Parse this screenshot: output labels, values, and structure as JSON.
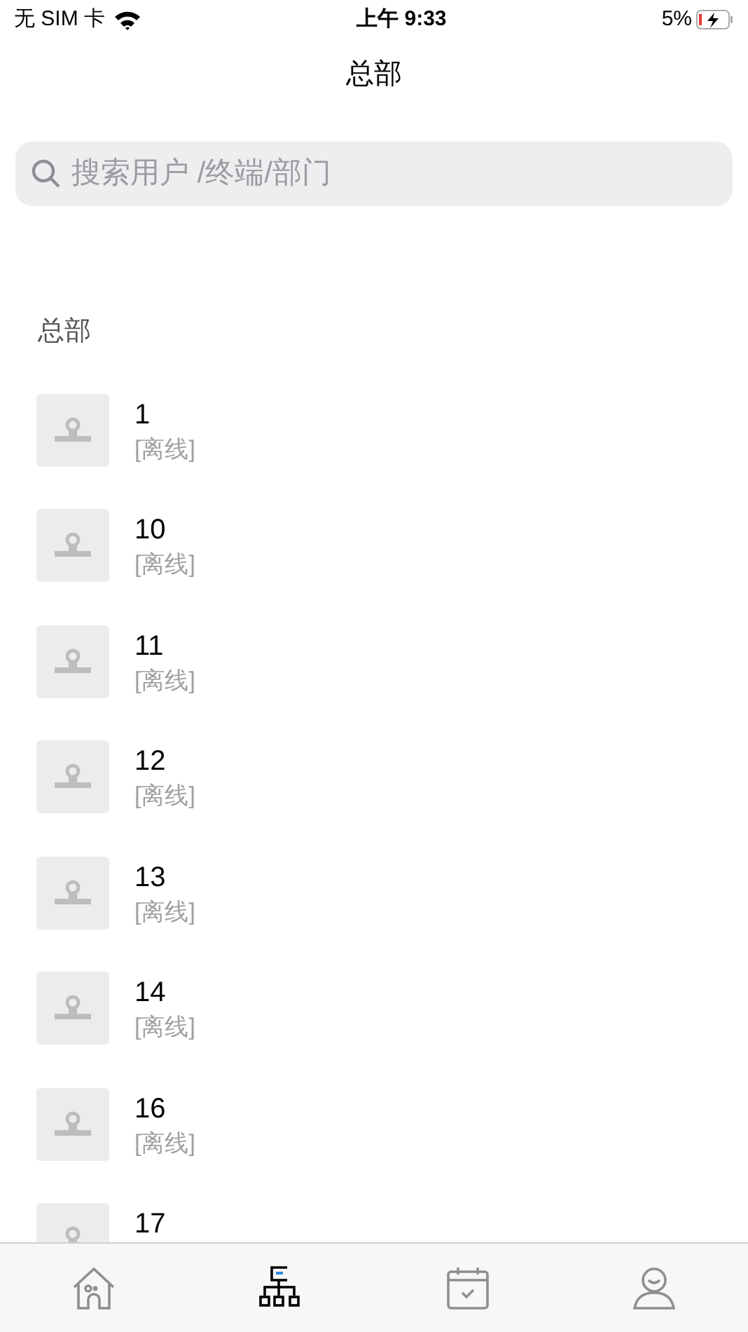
{
  "status_bar": {
    "carrier": "无 SIM 卡",
    "time": "上午 9:33",
    "battery": "5%"
  },
  "title": "总部",
  "search": {
    "placeholder": "搜索用户 /终端/部门"
  },
  "section": "总部",
  "users": [
    {
      "name": "1",
      "status": "[离线]"
    },
    {
      "name": "10",
      "status": "[离线]"
    },
    {
      "name": "11",
      "status": "[离线]"
    },
    {
      "name": "12",
      "status": "[离线]"
    },
    {
      "name": "13",
      "status": "[离线]"
    },
    {
      "name": "14",
      "status": "[离线]"
    },
    {
      "name": "16",
      "status": "[离线]"
    },
    {
      "name": "17"
    }
  ],
  "tabs": [
    {
      "kind": "home",
      "selected": false
    },
    {
      "kind": "org",
      "selected": true
    },
    {
      "kind": "calendar",
      "selected": false
    },
    {
      "kind": "profile",
      "selected": false
    }
  ]
}
